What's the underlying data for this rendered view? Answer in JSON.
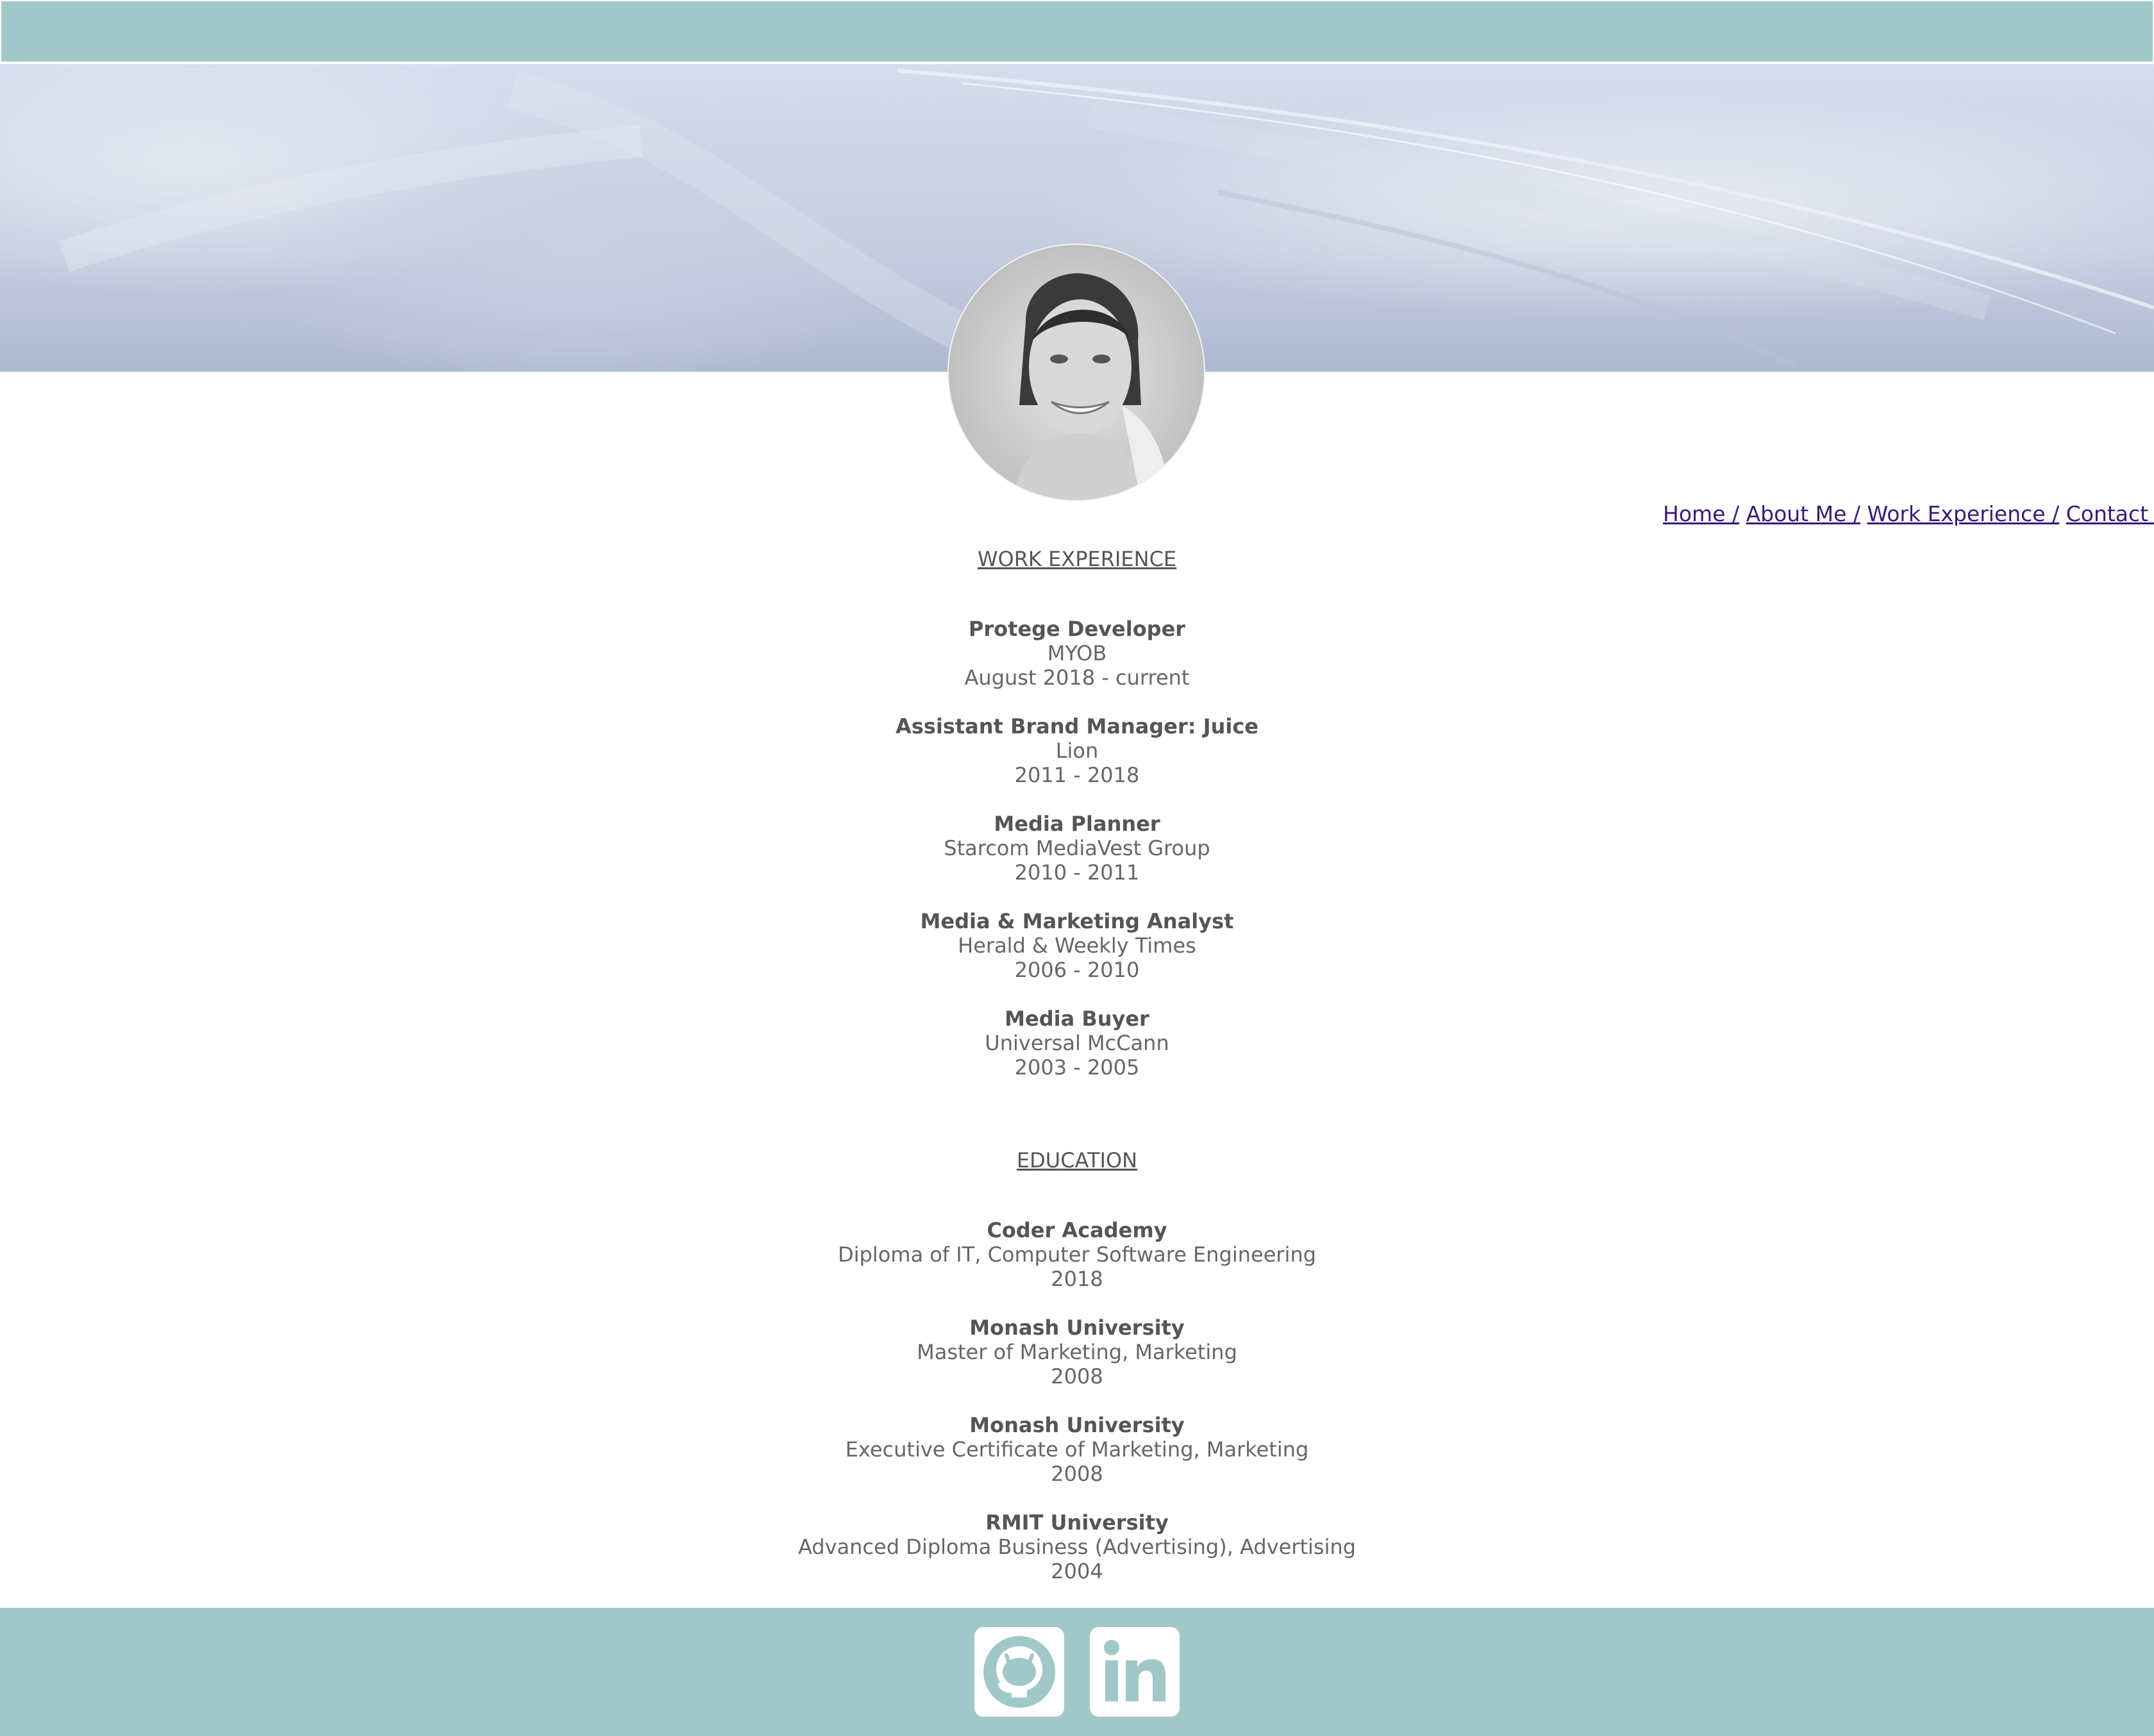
{
  "nav": {
    "items": [
      {
        "label": "Home /"
      },
      {
        "label": "About Me /"
      },
      {
        "label": "Work Experience /"
      },
      {
        "label": "Contact Me"
      }
    ]
  },
  "work": {
    "title": "WORK EXPERIENCE",
    "entries": [
      {
        "role": "Protege Developer",
        "org": "MYOB",
        "date": "August 2018 - current"
      },
      {
        "role": "Assistant Brand Manager: Juice",
        "org": "Lion",
        "date": "2011 - 2018"
      },
      {
        "role": "Media Planner",
        "org": "Starcom MediaVest Group",
        "date": "2010 - 2011"
      },
      {
        "role": "Media & Marketing Analyst",
        "org": "Herald & Weekly Times",
        "date": "2006 - 2010"
      },
      {
        "role": "Media Buyer",
        "org": "Universal McCann",
        "date": "2003 - 2005"
      }
    ]
  },
  "education": {
    "title": "EDUCATION",
    "entries": [
      {
        "school": "Coder Academy",
        "course": "Diploma of IT, Computer Software Engineering",
        "year": "2018"
      },
      {
        "school": "Monash University",
        "course": "Master of Marketing, Marketing",
        "year": "2008"
      },
      {
        "school": "Monash University",
        "course": "Executive Certificate of Marketing, Marketing",
        "year": "2008"
      },
      {
        "school": "RMIT University",
        "course": "Advanced Diploma Business (Advertising), Advertising",
        "year": "2004"
      }
    ]
  },
  "footer": {
    "icons": [
      "github-icon",
      "linkedin-icon"
    ]
  },
  "colors": {
    "bar": "#a1c8c8",
    "nav_link": "#3b1a78",
    "text": "#555555"
  }
}
